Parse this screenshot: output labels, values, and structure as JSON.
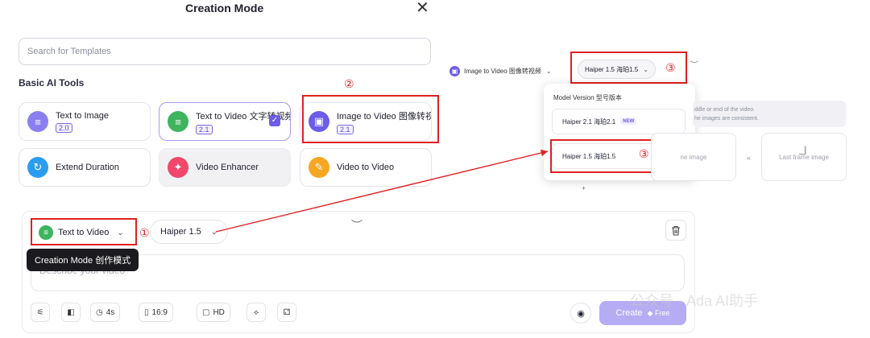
{
  "modal": {
    "title": "Creation Mode",
    "close_icon": "close-icon",
    "search_placeholder": "Search for Templates",
    "section_title": "Basic AI Tools",
    "tools": [
      {
        "name": "Text to Image",
        "version": "2.0",
        "icon": "text-image-icon",
        "color": "#8b7ff0"
      },
      {
        "name": "Text to Video 文字转视频",
        "version": "2.1",
        "icon": "text-video-icon",
        "color": "#3fb45f",
        "selected": true
      },
      {
        "name": "Image to Video 图像转视",
        "version": "2.1",
        "icon": "image-video-icon",
        "color": "#6c5ce7"
      },
      {
        "name": "Extend Duration",
        "icon": "extend-icon",
        "color": "#2b9df0"
      },
      {
        "name": "Video Enhancer",
        "icon": "enhancer-icon",
        "color": "#f0476b"
      },
      {
        "name": "Video to Video",
        "icon": "video-video-icon",
        "color": "#f5a623"
      }
    ]
  },
  "annotations": {
    "one": "①",
    "two": "②",
    "three": "③",
    "three_b": "③"
  },
  "right_panel": {
    "mode_label": "Image to Video 图像转视频",
    "model_label": "Haiper 1.5 海珀1.5",
    "dropdown": {
      "title": "Model Version 型号版本",
      "items": [
        {
          "label": "Haiper 2.1 海珀2.1",
          "badge": "NEW"
        },
        {
          "label": "Haiper 1.5 海珀1.5",
          "selected": true
        }
      ]
    },
    "info_lines": [
      "ddle or end of the video.",
      "he images are consistent."
    ],
    "frames": {
      "first": "ne image",
      "last": "Last frame image"
    },
    "plus": "+"
  },
  "composer": {
    "mode_label": "Text to Video",
    "model_label": "Haiper 1.5",
    "tooltip": "Creation Mode 创作模式",
    "prompt_placeholder": "Describe your video",
    "tools": [
      {
        "name": "settings-button",
        "icon": "sliders-icon",
        "label": ""
      },
      {
        "name": "style-button",
        "icon": "style-icon",
        "label": ""
      },
      {
        "name": "duration-button",
        "icon": "timer-icon",
        "label": "4s"
      },
      {
        "name": "ratio-button",
        "icon": "ratio-icon",
        "label": "16:9"
      },
      {
        "name": "resolution-button",
        "icon": "hd-icon",
        "label": "HD"
      },
      {
        "name": "motion-button",
        "icon": "motion-icon",
        "label": ""
      },
      {
        "name": "seed-button",
        "icon": "dice-icon",
        "label": ""
      }
    ],
    "create_label": "Create",
    "free_label": "Free"
  },
  "watermark": "公众号 · Ada AI助手"
}
